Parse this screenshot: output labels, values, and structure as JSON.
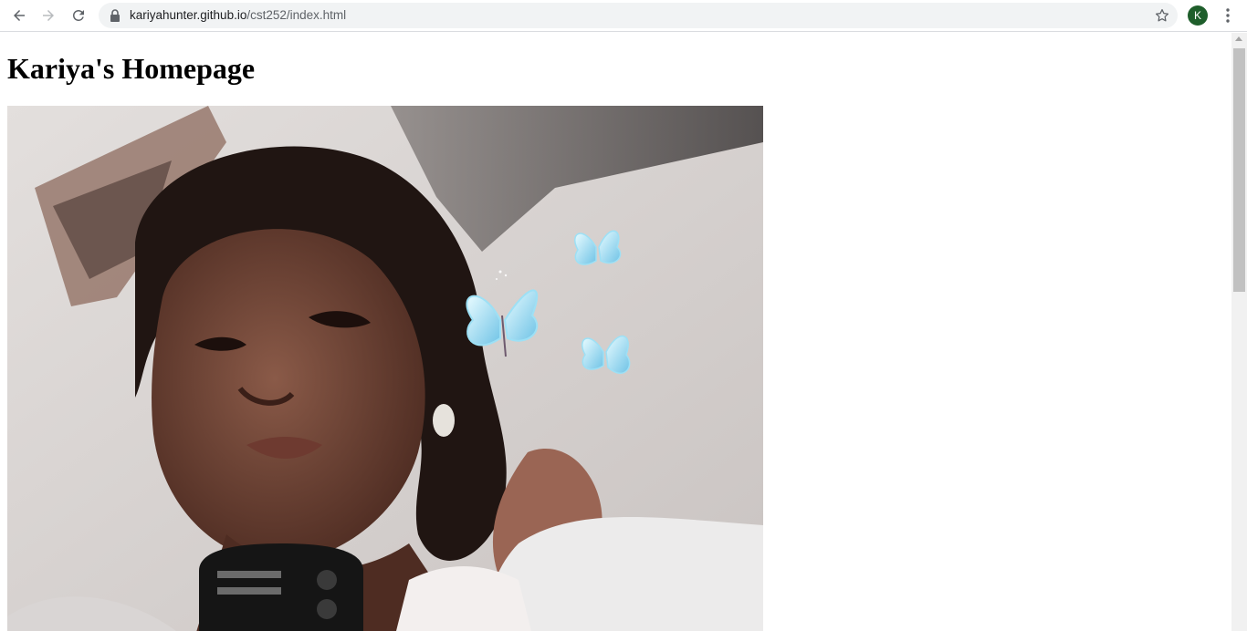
{
  "browser": {
    "url_host": "kariyahunter.github.io",
    "url_path": "/cst252/index.html",
    "profile_initial": "K",
    "icons": [
      "back-arrow-icon",
      "forward-arrow-icon",
      "reload-icon",
      "lock-icon",
      "star-icon",
      "kebab-menu-icon"
    ]
  },
  "page": {
    "title": "Kariya's Homepage"
  },
  "colors": {
    "avatar_bg": "#1e5e2b",
    "omnibox_bg": "#f1f3f4"
  }
}
